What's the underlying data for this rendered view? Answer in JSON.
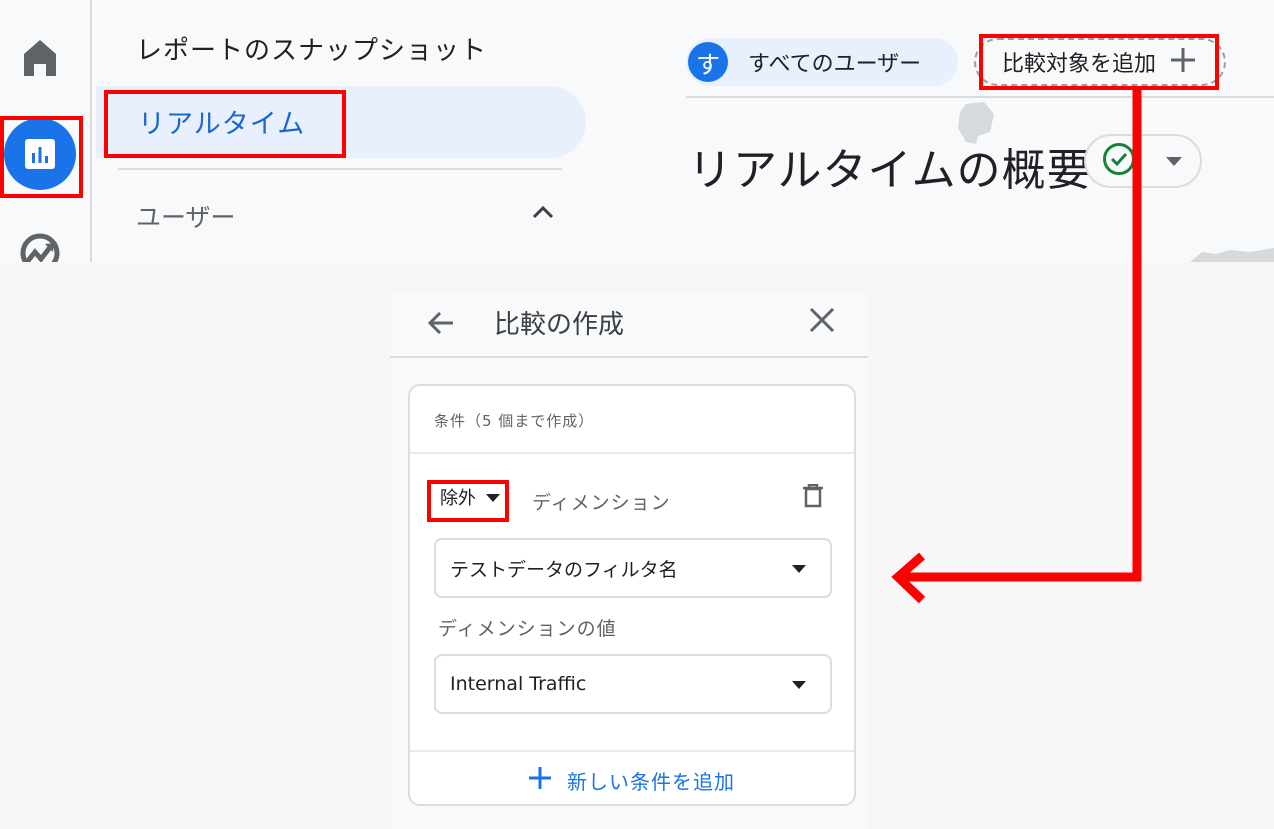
{
  "rail": {
    "items": [
      {
        "name": "home",
        "icon": "home-icon"
      },
      {
        "name": "reports",
        "icon": "bar-chart-icon",
        "active": true
      },
      {
        "name": "explore",
        "icon": "explore-icon"
      }
    ]
  },
  "nav": {
    "title": "レポートのスナップショット",
    "selected_item": "リアルタイム",
    "section": "ユーザー"
  },
  "header": {
    "segment_chip": {
      "avatar": "す",
      "label": "すべてのユーザー"
    },
    "add_comparison": "比較対象を追加",
    "page_title": "リアルタイムの概要"
  },
  "panel": {
    "title": "比較の作成",
    "caption": "条件（5 個まで作成）",
    "mode": "除外",
    "dimension_label": "ディメンション",
    "dimension_value": "テストデータのフィルタ名",
    "value_label": "ディメンションの値",
    "value_selected": "Internal Traffic",
    "add_condition": "新しい条件を追加"
  },
  "colors": {
    "accent": "#1a73e8",
    "selected_bg": "#e8f0fe",
    "annotation": "#ff0000",
    "status_ok": "#188038"
  }
}
